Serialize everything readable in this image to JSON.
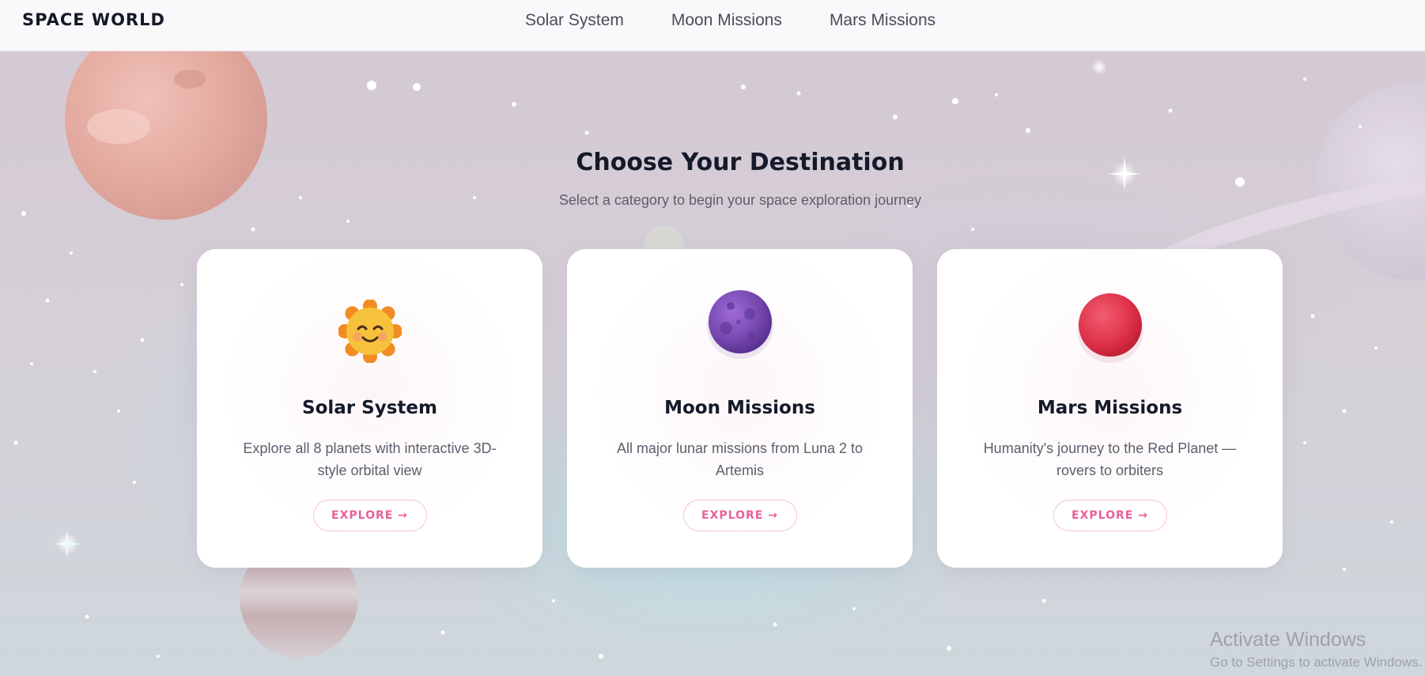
{
  "header": {
    "brand": "SPACE WORLD",
    "nav": [
      {
        "label": "Solar System"
      },
      {
        "label": "Moon Missions"
      },
      {
        "label": "Mars Missions"
      }
    ]
  },
  "hero": {
    "title": "Choose Your Destination",
    "subtitle": "Select a category to begin your space exploration journey"
  },
  "cards": [
    {
      "icon": "smiling-sun-icon",
      "title": "Solar System",
      "description": "Explore all 8 planets with interactive 3D-style orbital view",
      "button": "EXPLORE →"
    },
    {
      "icon": "purple-moon-icon",
      "title": "Moon Missions",
      "description": "All major lunar missions from Luna 2 to Artemis",
      "button": "EXPLORE →"
    },
    {
      "icon": "red-planet-icon",
      "title": "Mars Missions",
      "description": "Humanity's journey to the Red Planet — rovers to orbiters",
      "button": "EXPLORE →"
    }
  ],
  "watermark": {
    "title": "Activate Windows",
    "subtitle": "Go to Settings to activate Windows."
  },
  "colors": {
    "accent_pink": "#ea5f98",
    "heading": "#151a2a",
    "body_text": "#5b5f6c",
    "sun": "#f3b93c",
    "moon": "#7e4cb3",
    "mars": "#e0344e"
  }
}
